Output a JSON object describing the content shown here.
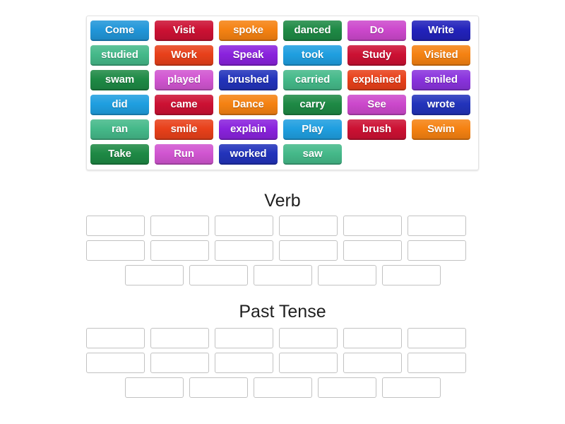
{
  "page": {
    "background": "#ffffff"
  },
  "tile_bank": {
    "name": "word-tile-bank",
    "rows": [
      [
        {
          "label": "Come",
          "color": "#2196d9"
        },
        {
          "label": "Visit",
          "color": "#cc1133"
        },
        {
          "label": "spoke",
          "color": "#f58212"
        },
        {
          "label": "danced",
          "color": "#1e8a45"
        },
        {
          "label": "Do",
          "color": "#cc48cc"
        },
        {
          "label": "Write",
          "color": "#2222bb"
        }
      ],
      [
        {
          "label": "studied",
          "color": "#45b98a"
        },
        {
          "label": "Work",
          "color": "#e8401a"
        },
        {
          "label": "Speak",
          "color": "#8a22dd"
        },
        {
          "label": "took",
          "color": "#1f9fe0"
        },
        {
          "label": "Study",
          "color": "#cc1133"
        },
        {
          "label": "Visited",
          "color": "#f58212"
        }
      ],
      [
        {
          "label": "swam",
          "color": "#1e8a45"
        },
        {
          "label": "played",
          "color": "#d155d1"
        },
        {
          "label": "brushed",
          "color": "#2233bb"
        },
        {
          "label": "carried",
          "color": "#45b98a"
        },
        {
          "label": "explained",
          "color": "#e8401a"
        },
        {
          "label": "smiled",
          "color": "#8a33dd"
        }
      ],
      [
        {
          "label": "did",
          "color": "#1f9fe0"
        },
        {
          "label": "came",
          "color": "#cc1133"
        },
        {
          "label": "Dance",
          "color": "#f58212"
        },
        {
          "label": "carry",
          "color": "#1e8a45"
        },
        {
          "label": "See",
          "color": "#cc48cc"
        },
        {
          "label": "wrote",
          "color": "#2233bb"
        }
      ],
      [
        {
          "label": "ran",
          "color": "#45b98a"
        },
        {
          "label": "smile",
          "color": "#e8401a"
        },
        {
          "label": "explain",
          "color": "#8a22dd"
        },
        {
          "label": "Play",
          "color": "#1f9fe0"
        },
        {
          "label": "brush",
          "color": "#cc1133"
        },
        {
          "label": "Swim",
          "color": "#f58212"
        }
      ],
      [
        {
          "label": "Take",
          "color": "#1e8a45"
        },
        {
          "label": "Run",
          "color": "#d155d1"
        },
        {
          "label": "worked",
          "color": "#2233bb"
        },
        {
          "label": "saw",
          "color": "#45b98a"
        }
      ]
    ]
  },
  "sections": [
    {
      "title": "Verb",
      "zone_rows": [
        6,
        6,
        5
      ],
      "zone_values": [
        [
          "",
          "",
          "",
          "",
          "",
          ""
        ],
        [
          "",
          "",
          "",
          "",
          "",
          ""
        ],
        [
          "",
          "",
          "",
          "",
          ""
        ]
      ]
    },
    {
      "title": "Past Tense",
      "zone_rows": [
        6,
        6,
        5
      ],
      "zone_values": [
        [
          "",
          "",
          "",
          "",
          "",
          ""
        ],
        [
          "",
          "",
          "",
          "",
          "",
          ""
        ],
        [
          "",
          "",
          "",
          "",
          ""
        ]
      ]
    }
  ]
}
